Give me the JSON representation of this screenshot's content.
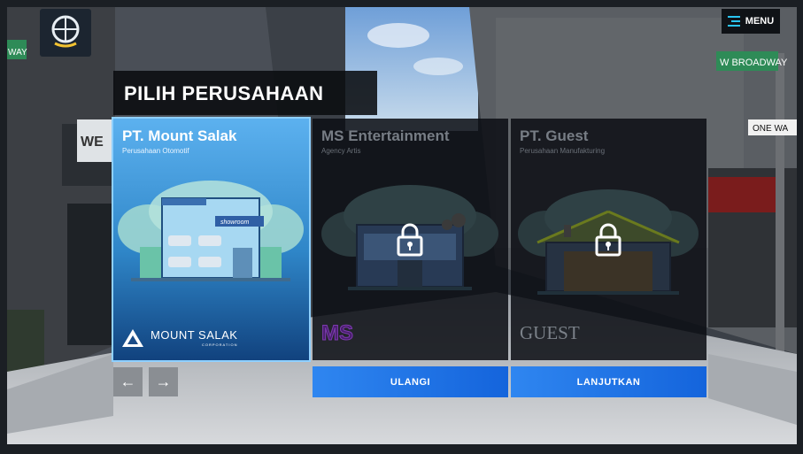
{
  "header": {
    "menu_label": "MENU"
  },
  "street_signs": {
    "left_sign": "WAY",
    "right_sign": "W BROADWAY",
    "one_way": "ONE WA",
    "shop_letters": "WE"
  },
  "title": "PILIH PERUSAHAAN",
  "companies": [
    {
      "name": "PT. Mount Salak",
      "subtitle": "Perusahaan Otomotif",
      "state": "selected",
      "brand_main": "MOUNT SALAK",
      "brand_sub": "CORPORATION",
      "showroom_sign": "showroom"
    },
    {
      "name": "MS Entertainment",
      "subtitle": "Agency Artis",
      "state": "locked",
      "brand_main": "MS"
    },
    {
      "name": "PT. Guest",
      "subtitle": "Perusahaan Manufakturing",
      "state": "locked",
      "brand_main": "GUEST"
    }
  ],
  "navigation": {
    "prev_symbol": "←",
    "next_symbol": "→"
  },
  "actions": {
    "reset_label": "ULANGI",
    "continue_label": "LANJUTKAN"
  },
  "colors": {
    "accent_blue": "#1f74e6",
    "selected_card": "#3c98dc",
    "dark_panel": "#0c0e14"
  }
}
